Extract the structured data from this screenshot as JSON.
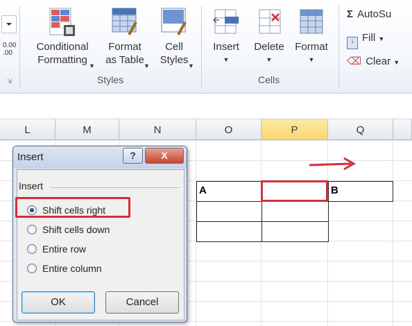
{
  "ribbon": {
    "left_cut": "0.00\n.00",
    "styles": {
      "conditional_formatting": "Conditional\nFormatting",
      "format_as_table": "Format\nas Table",
      "cell_styles": "Cell\nStyles",
      "group_label": "Styles"
    },
    "cells": {
      "insert": "Insert",
      "delete": "Delete",
      "format": "Format",
      "group_label": "Cells"
    },
    "editing": {
      "autosum": "AutoSu",
      "fill": "Fill",
      "clear": "Clear"
    }
  },
  "columns": [
    "L",
    "M",
    "N",
    "O",
    "P",
    "Q"
  ],
  "sheet": {
    "cell_a": "A",
    "cell_b": "B"
  },
  "dialog": {
    "title": "Insert",
    "help": "?",
    "close": "X",
    "group_label": "Insert",
    "options": [
      "Shift cells right",
      "Shift cells down",
      "Entire row",
      "Entire column"
    ],
    "selected_option": "Shift cells right",
    "ok": "OK",
    "cancel": "Cancel"
  },
  "colors": {
    "highlight": "#d32f3a",
    "selected_column": "#f9d870"
  }
}
